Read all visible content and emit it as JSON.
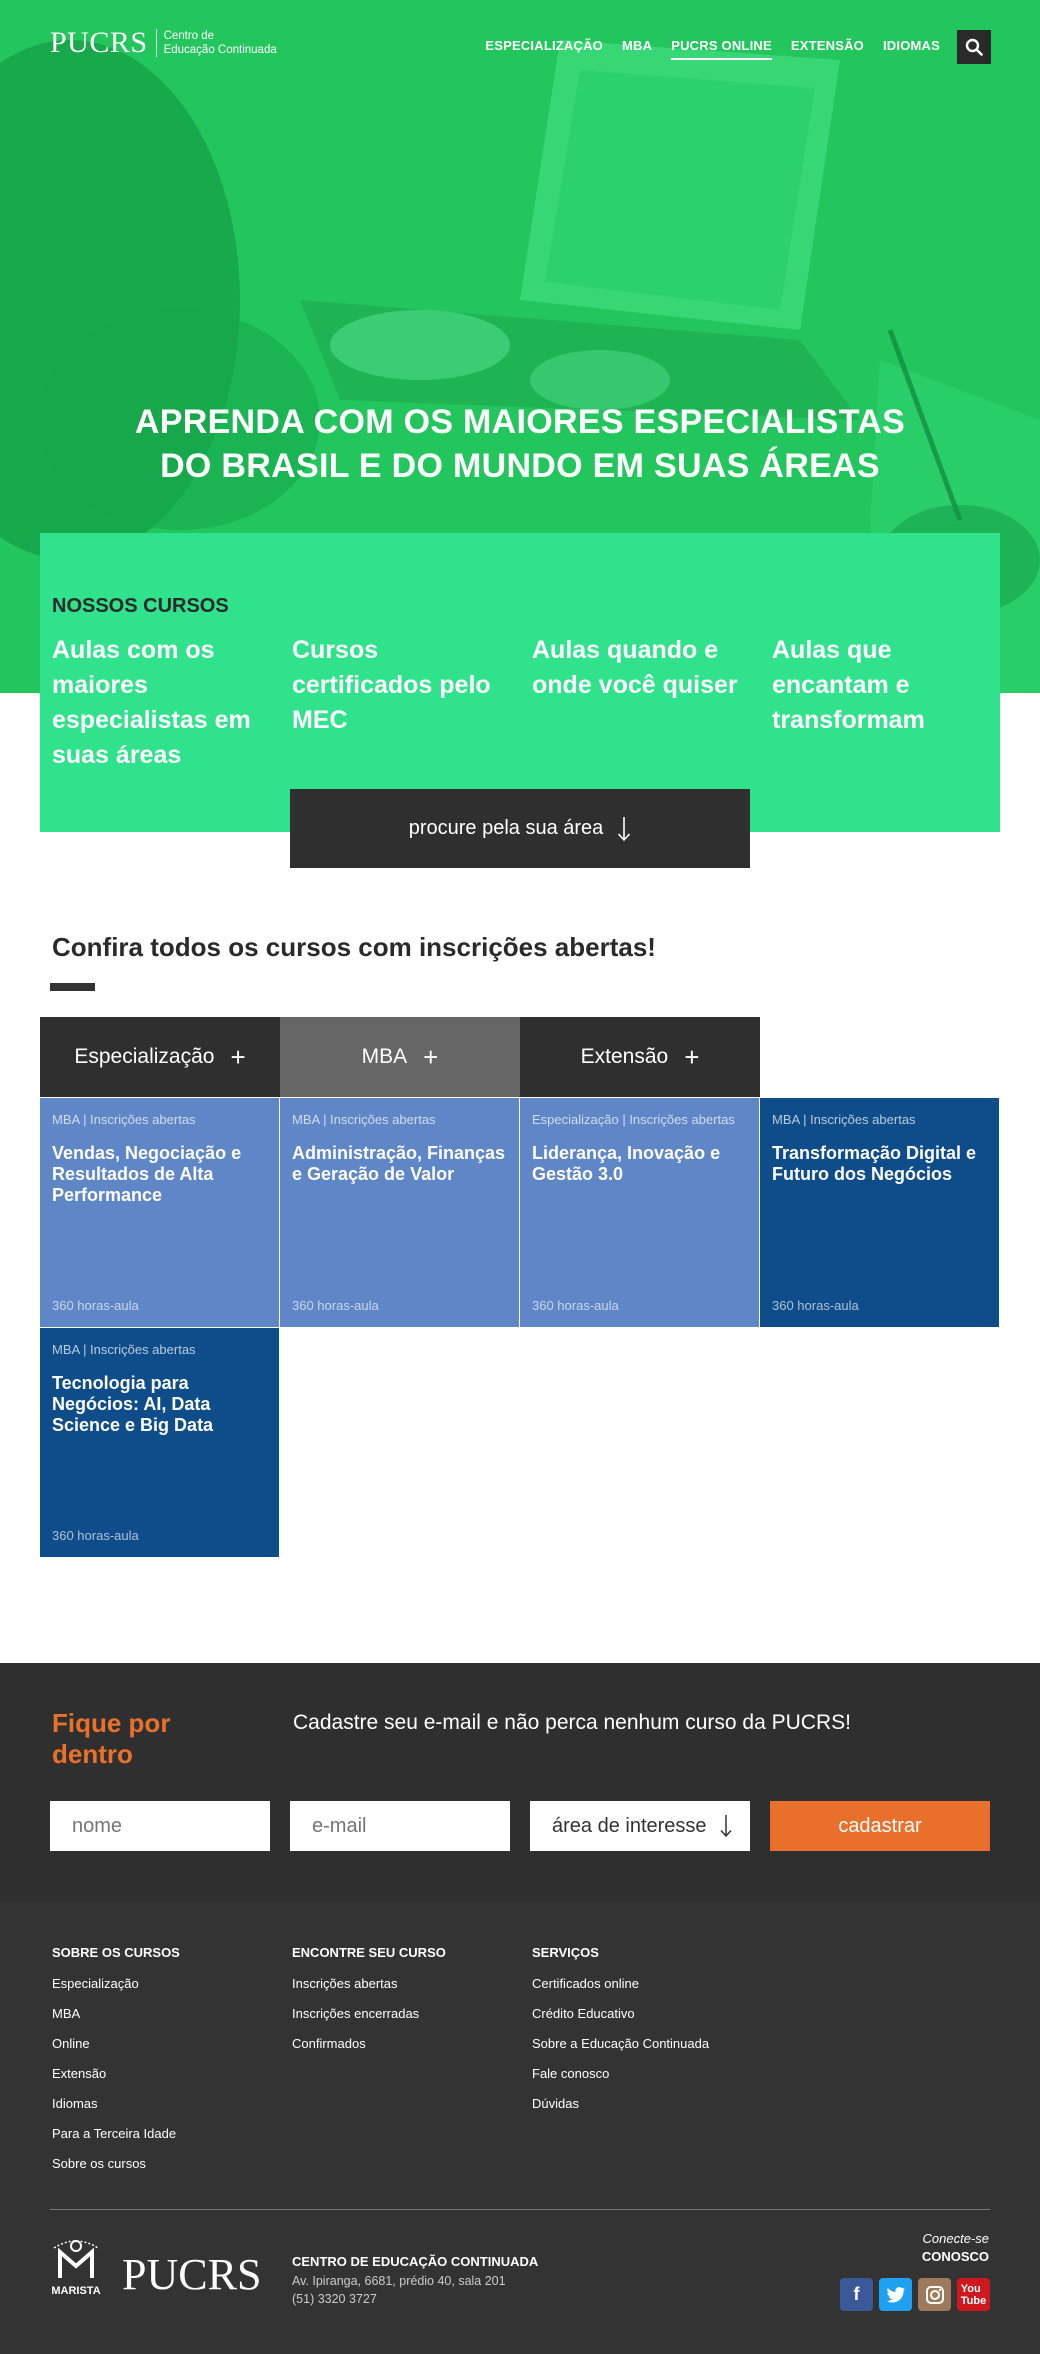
{
  "header": {
    "logo_main": "PUCRS",
    "logo_sub_line1": "Centro de",
    "logo_sub_line2": "Educação Continuada",
    "nav": [
      "ESPECIALIZAÇÃO",
      "MBA",
      "PUCRS ONLINE",
      "EXTENSÃO",
      "IDIOMAS"
    ],
    "active_nav": "PUCRS ONLINE",
    "search_icon": "search-icon"
  },
  "hero": {
    "title_line1": "APRENDA COM OS MAIORES ESPECIALISTAS",
    "title_line2": "DO BRASIL E DO MUNDO EM SUAS ÁREAS",
    "bg_color": "#20c35c"
  },
  "nossos_cursos": {
    "heading": "NOSSOS CURSOS",
    "features": [
      "Aulas com os maiores especialistas em suas áreas",
      "Cursos certificados pelo MEC",
      "Aulas quando e onde você quiser",
      "Aulas que encantam e transformam"
    ],
    "button_label": "procure pela sua área",
    "bg_color": "#2fe28b"
  },
  "inscricoes": {
    "title": "Confira todos os cursos com inscrições abertas!",
    "tabs": [
      {
        "label": "Especialização",
        "selected": false
      },
      {
        "label": "MBA",
        "selected": true
      },
      {
        "label": "Extensão",
        "selected": false
      }
    ],
    "cards": [
      {
        "tag": "MBA | Inscrições abertas",
        "title": "Vendas, Negociação e Resultados de Alta Performance",
        "hours": "360 horas-aula",
        "style": "light"
      },
      {
        "tag": "MBA | Inscrições abertas",
        "title": "Administração, Finanças e Geração de Valor",
        "hours": "360 horas-aula",
        "style": "light"
      },
      {
        "tag": "Especialização | Inscrições abertas",
        "title": "Liderança, Inovação e Gestão 3.0",
        "hours": "360 horas-aula",
        "style": "light"
      },
      {
        "tag": "MBA | Inscrições abertas",
        "title": "Transformação Digital e Futuro dos Negócios",
        "hours": "360 horas-aula",
        "style": "dark"
      },
      {
        "tag": "MBA | Inscrições abertas",
        "title": "Tecnologia para Negócios: AI, Data Science e Big Data",
        "hours": "360 horas-aula",
        "style": "dark"
      }
    ]
  },
  "newsletter": {
    "title": "Fique por dentro",
    "text": "Cadastre seu e-mail e não perca nenhum curso da PUCRS!",
    "name_placeholder": "nome",
    "email_placeholder": "e-mail",
    "area_select": "área de interesse",
    "submit_label": "cadastrar",
    "accent_color": "#e8722c"
  },
  "footer": {
    "columns": [
      {
        "heading": "SOBRE OS CURSOS",
        "links": [
          "Especialização",
          "MBA",
          "Online",
          "Extensão",
          "Idiomas",
          "Para a Terceira Idade",
          "Sobre os cursos"
        ]
      },
      {
        "heading": "ENCONTRE SEU CURSO",
        "links": [
          "Inscrições abertas",
          "Inscrições encerradas",
          "Confirmados"
        ]
      },
      {
        "heading": "SERVIÇOS",
        "links": [
          "Certificados online",
          "Crédito Educativo",
          "Sobre a Educação Continuada",
          "Fale conosco",
          "Dúvidas"
        ]
      }
    ],
    "marista_label": "MARISTA",
    "logo": "PUCRS",
    "org_name": "CENTRO DE EDUCAÇÃO CONTINUADA",
    "address": "Av. Ipiranga, 6681, prédio 40, sala 201",
    "phone": "(51) 3320 3727",
    "connect_line1": "Conecte-se",
    "connect_line2": "CONOSCO",
    "socials": [
      "facebook-icon",
      "twitter-icon",
      "instagram-icon",
      "youtube-icon"
    ]
  }
}
